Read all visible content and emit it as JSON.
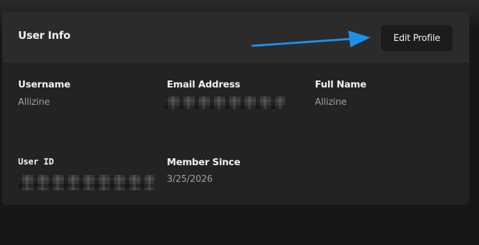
{
  "card": {
    "title": "User Info",
    "edit_button_label": "Edit Profile"
  },
  "fields": {
    "username": {
      "label": "Username",
      "value": "Allizine"
    },
    "email": {
      "label": "Email Address",
      "value": ""
    },
    "full_name": {
      "label": "Full Name",
      "value": "Allizine"
    },
    "user_id": {
      "label": "User ID",
      "value": ""
    },
    "member_since": {
      "label": "Member Since",
      "value": "3/25/2026"
    }
  },
  "colors": {
    "page_background": "#171717",
    "card_background": "#232323",
    "header_background": "#2b2b2b",
    "button_background": "#1c1c1c",
    "annotation_arrow": "#1e90e8"
  },
  "icons": {
    "annotation": "arrow-right-icon"
  }
}
